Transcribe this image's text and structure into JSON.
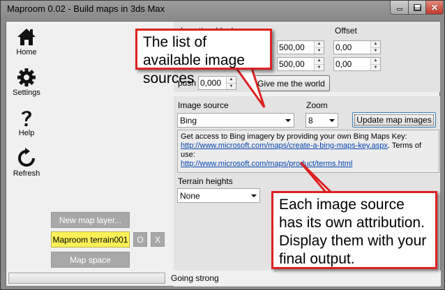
{
  "window": {
    "title": "Maproom 0.02 - Build maps in 3ds Max",
    "min_label": "",
    "close_glyph": "✕"
  },
  "nav": {
    "home": "Home",
    "settings": "Settings",
    "help": "Help",
    "refresh": "Refresh"
  },
  "left": {
    "new_layer": "New map layer...",
    "terrain_item": "Maproom terrain001",
    "o_button": "O",
    "x_button": "X",
    "map_space": "Map space"
  },
  "location": {
    "heading": "Location (deg)",
    "offset_heading": "Offset",
    "row1_left_value": "500,00",
    "row1_offset_value": "0,00",
    "row2_left_value": "500,00",
    "row2_offset_value": "0,00",
    "push_label": "push",
    "push_value": "0,000",
    "give_world": "Give me the world"
  },
  "source": {
    "image_source_label": "Image source",
    "image_source_value": "Bing",
    "zoom_label": "Zoom",
    "zoom_value": "8",
    "update_button": "Update map images",
    "attribution_text": "Get access to Bing imagery by providing your own Bing Maps Key:",
    "key_link": "http://www.microsoft.com/maps/create-a-bing-maps-key.aspx",
    "terms_text": ". Terms of use:",
    "terms_link": "http://www.microsoft.com/maps/product/terms.html",
    "terrain_label": "Terrain heights",
    "terrain_value": "None"
  },
  "status": {
    "text": "Going strong",
    "progress": 0
  },
  "callouts": {
    "top": "The list of available image sources",
    "bottom": "Each image source has its own attribution. Display them with your final output."
  },
  "colors": {
    "accent_yellow": "#fbf157",
    "callout_red": "#dd2222",
    "link_blue": "#0645ad"
  }
}
